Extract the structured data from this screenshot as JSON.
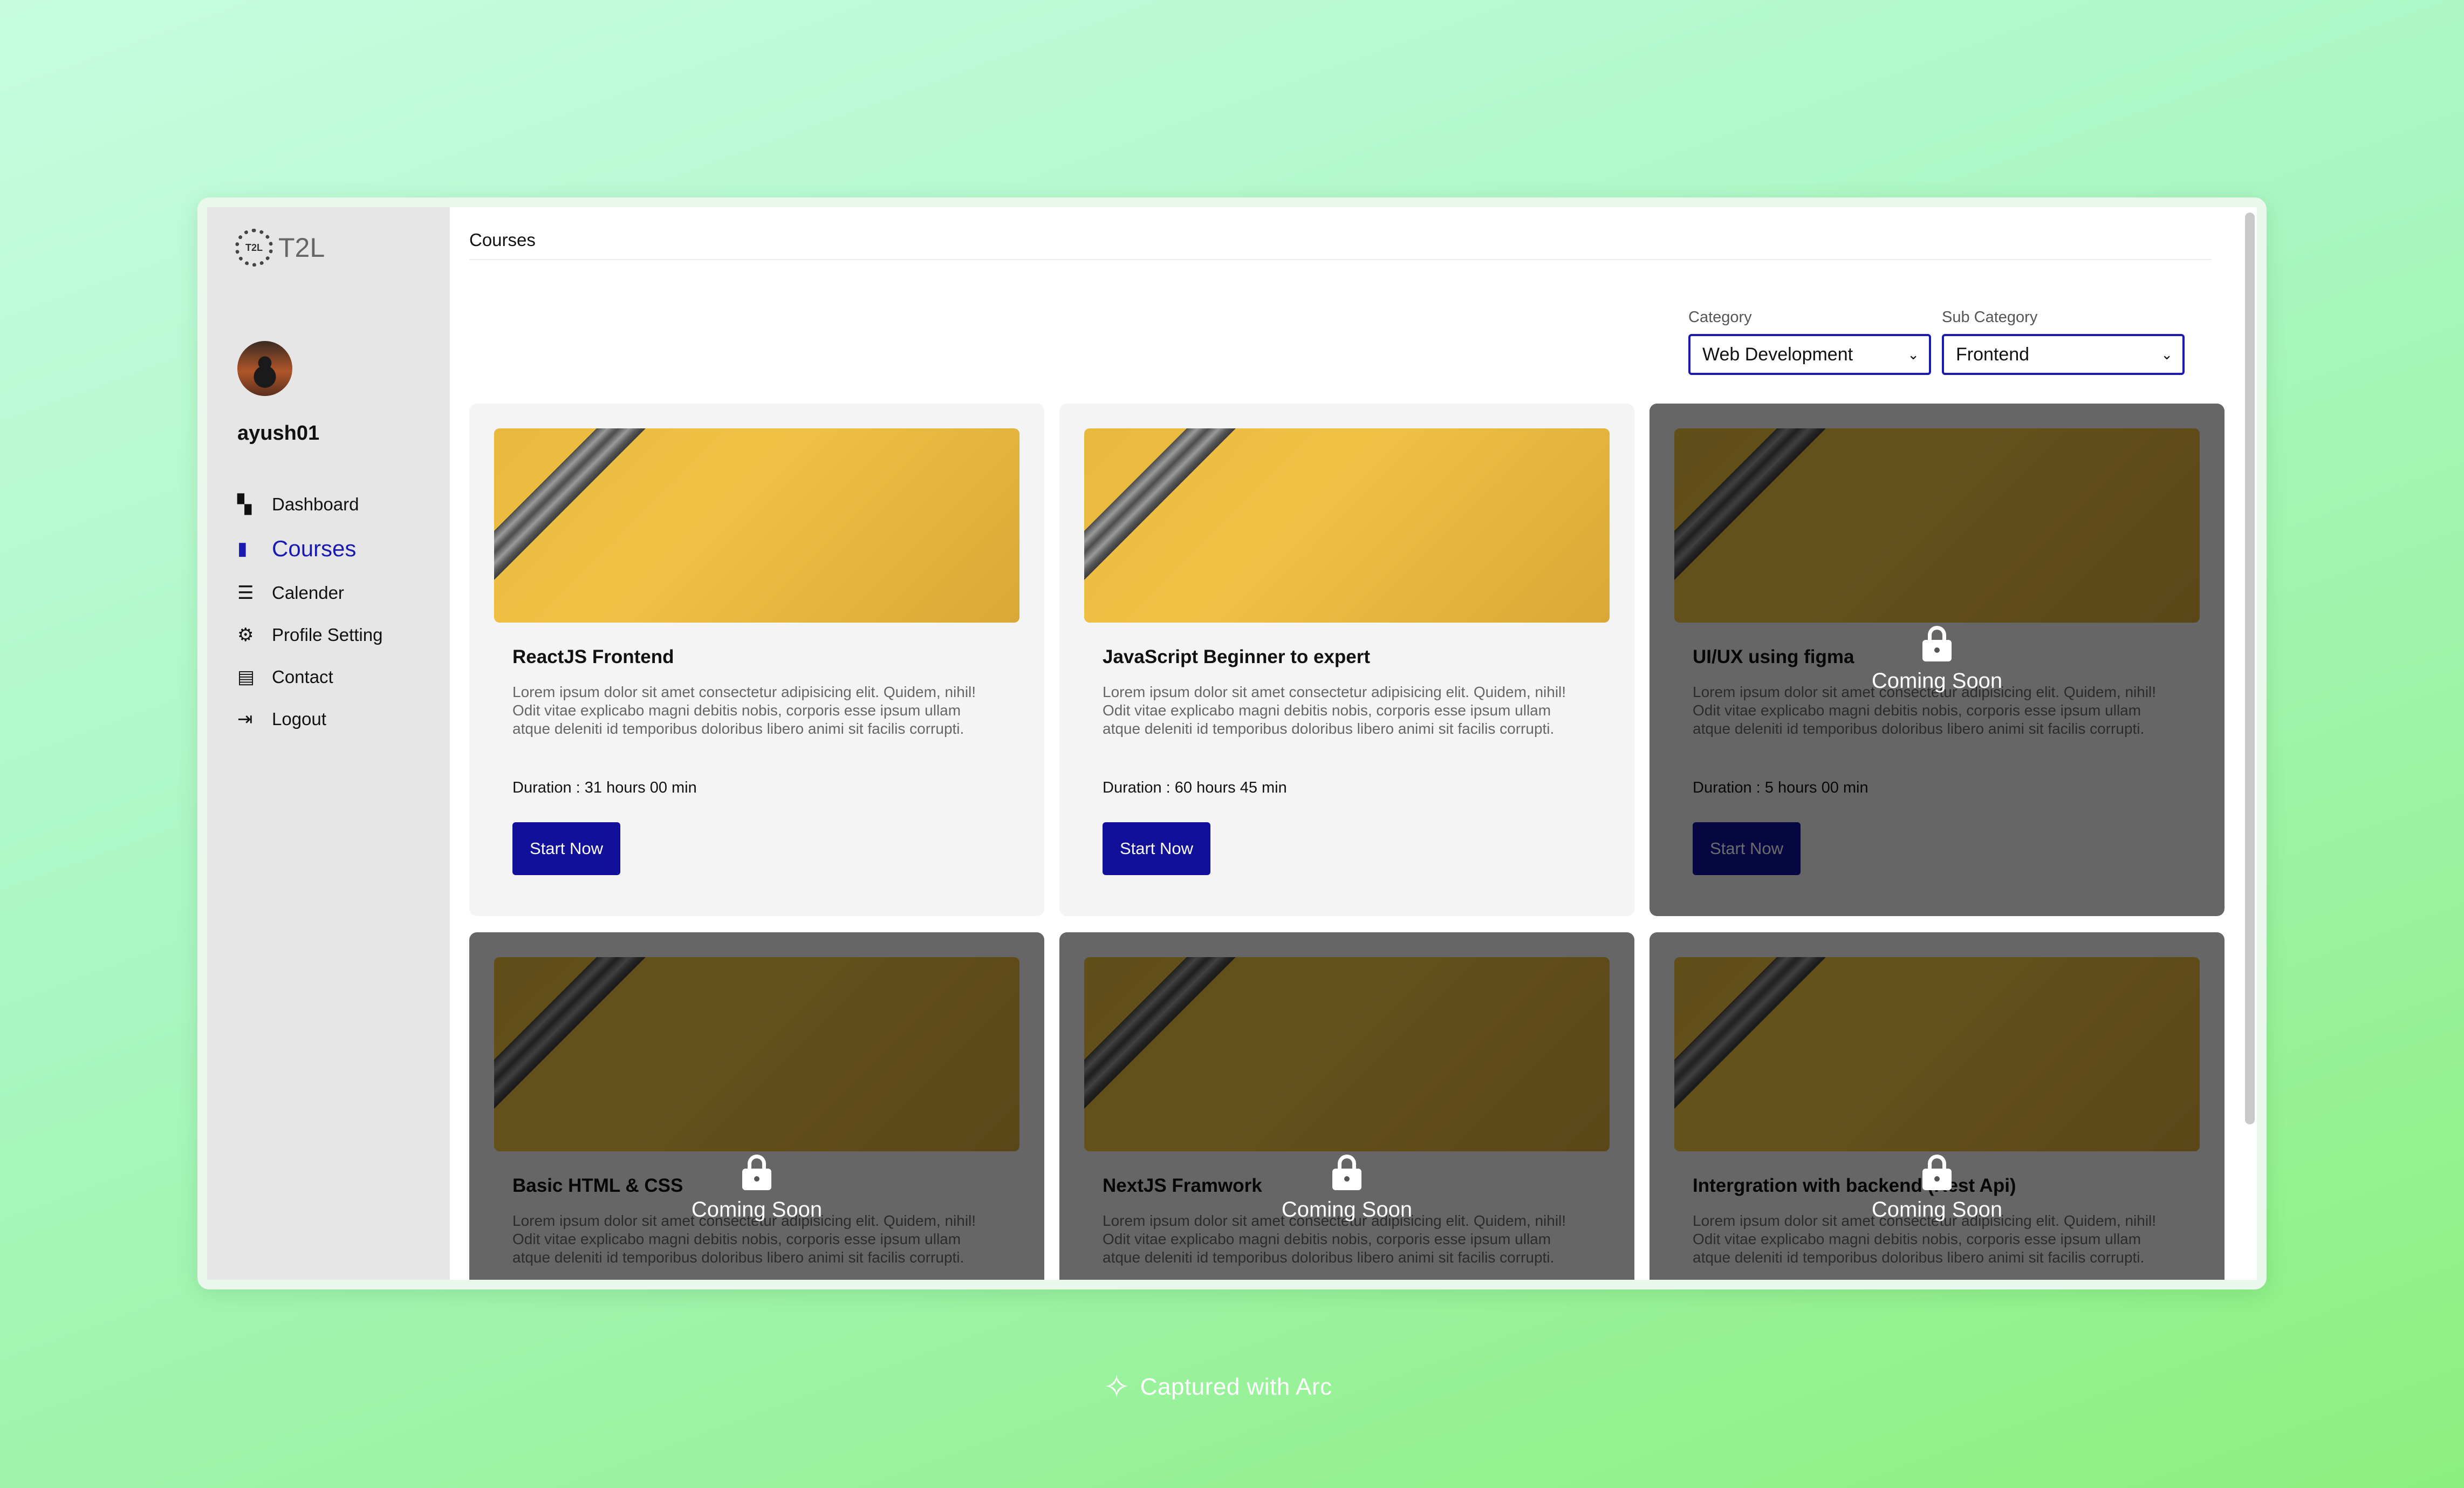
{
  "brand": {
    "logo_mark": "T2L",
    "name": "T2L"
  },
  "user": {
    "username": "ayush01"
  },
  "sidebar": {
    "items": [
      {
        "label": "Dashboard",
        "icon": "dashboard-icon",
        "active": false
      },
      {
        "label": "Courses",
        "icon": "book-icon",
        "active": true
      },
      {
        "label": "Calender",
        "icon": "calendar-icon",
        "active": false
      },
      {
        "label": "Profile Setting",
        "icon": "gear-icon",
        "active": false
      },
      {
        "label": "Contact",
        "icon": "contact-icon",
        "active": false
      },
      {
        "label": "Logout",
        "icon": "logout-icon",
        "active": false
      }
    ]
  },
  "main": {
    "breadcrumb": "Courses",
    "filters": {
      "category": {
        "label": "Category",
        "value": "Web Development"
      },
      "sub_category": {
        "label": "Sub Category",
        "value": "Frontend"
      }
    },
    "start_label": "Start Now",
    "coming_soon_label": "Coming Soon",
    "description": "Lorem ipsum dolor sit amet consectetur adipisicing elit. Quidem, nihil! Odit vitae explicabo magni debitis nobis, corporis esse ipsum ullam atque deleniti id temporibus doloribus libero animi sit facilis corrupti.",
    "courses": [
      {
        "title": "ReactJS Frontend",
        "duration": "Duration : 31 hours 00 min",
        "locked": false
      },
      {
        "title": "JavaScript Beginner to expert",
        "duration": "Duration : 60 hours 45 min",
        "locked": false
      },
      {
        "title": "UI/UX using figma",
        "duration": "Duration : 5 hours 00 min",
        "locked": true
      },
      {
        "title": "Basic HTML & CSS",
        "duration": "",
        "locked": true
      },
      {
        "title": "NextJS Framwork",
        "duration": "",
        "locked": true
      },
      {
        "title": "Intergration with backend (Rest Api)",
        "duration": "",
        "locked": true
      }
    ]
  },
  "footer": {
    "text": "Captured with Arc"
  },
  "colors": {
    "accent": "#10109a",
    "nav_active": "#1a1ab0",
    "sidebar_bg": "#e6e6e6"
  }
}
